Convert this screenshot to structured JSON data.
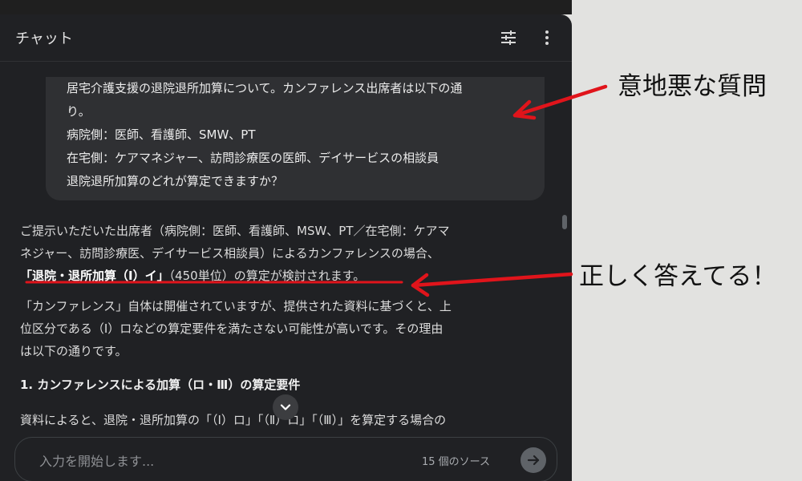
{
  "panel": {
    "title": "チャット",
    "icons": {
      "tune": "tune-icon",
      "more": "more-vert-icon",
      "scroll_down": "chevron-down-icon",
      "send": "arrow-right-icon"
    }
  },
  "user_message": {
    "lines": [
      "居宅介護支援の退院退所加算について。カンファレンス出席者は以下の通",
      "り。",
      "病院側：医師、看護師、SMW、PT",
      "在宅側：ケアマネジャー、訪問診療医の医師、デイサービスの相談員",
      "退院退所加算のどれが算定できますか？"
    ]
  },
  "answer": {
    "p1_line1": "ご提示いただいた出席者（病院側：医師、看護師、MSW、PT／在宅側：ケアマ",
    "p1_line2": "ネジャー、訪問診療医、デイサービス相談員）によるカンファレンスの場合、",
    "p1_line3_bold": "「退院・退所加算（Ⅰ）イ」",
    "p1_line3_rest": "（450単位）の算定が検討されます。",
    "p2_line1": "「カンファレンス」自体は開催されていますが、提供された資料に基づくと、上",
    "p2_line2": "位区分である（Ⅰ）ロなどの算定要件を満たさない可能性が高いです。その理由",
    "p2_line3": "は以下の通りです。",
    "heading": "1. カンファレンスによる加算（ロ・Ⅲ）の算定要件",
    "p3_line1": "資料によると、退院・退所加算の「（Ⅰ）ロ」「（Ⅱ）ロ」「（Ⅲ）」を算定する場合の"
  },
  "input": {
    "placeholder": "入力を開始します...",
    "source_count": "15 個のソース"
  },
  "annotations": {
    "label1": "意地悪な質問",
    "label2": "正しく答えてる！",
    "arrow_color": "#e0141b"
  }
}
